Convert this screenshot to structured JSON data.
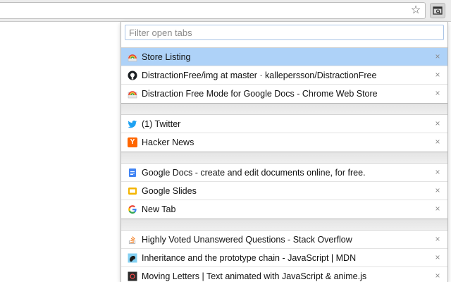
{
  "filter": {
    "placeholder": "Filter open tabs"
  },
  "groups": [
    {
      "tabs": [
        {
          "title": "Store Listing",
          "icon": "chrome-store-icon",
          "selected": true
        },
        {
          "title": "DistractionFree/img at master · kallepersson/DistractionFree",
          "icon": "github-icon"
        },
        {
          "title": "Distraction Free Mode for Google Docs - Chrome Web Store",
          "icon": "chrome-store-icon"
        }
      ]
    },
    {
      "tabs": [
        {
          "title": "(1) Twitter",
          "icon": "twitter-icon"
        },
        {
          "title": "Hacker News",
          "icon": "hacker-news-icon"
        }
      ]
    },
    {
      "tabs": [
        {
          "title": "Google Docs - create and edit documents online, for free.",
          "icon": "google-docs-icon"
        },
        {
          "title": "Google Slides",
          "icon": "google-slides-icon"
        },
        {
          "title": "New Tab",
          "icon": "google-icon"
        }
      ]
    },
    {
      "tabs": [
        {
          "title": "Highly Voted Unanswered Questions - Stack Overflow",
          "icon": "stack-overflow-icon"
        },
        {
          "title": "Inheritance and the prototype chain - JavaScript | MDN",
          "icon": "mdn-icon"
        },
        {
          "title": "Moving Letters | Text animated with JavaScript & anime.js",
          "icon": "anime-js-icon"
        }
      ]
    }
  ],
  "close_glyph": "×",
  "colors": {
    "selected_row": "#aed2f8",
    "filter_border": "#aac4e6"
  }
}
